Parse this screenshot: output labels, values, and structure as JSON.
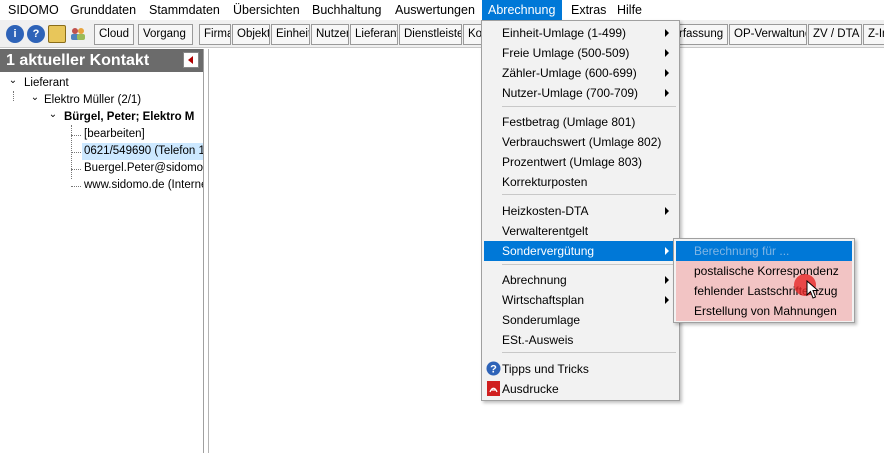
{
  "menubar": {
    "items": [
      "SIDOMO",
      "Grunddaten",
      "Stammdaten",
      "Übersichten",
      "Buchhaltung",
      "Auswertungen",
      "Abrechnung",
      "Extras",
      "Hilfe"
    ],
    "active": "Abrechnung"
  },
  "toolbar": {
    "icons": [
      "info-icon",
      "help-icon",
      "notes-icon",
      "users-icon"
    ],
    "icon_letters": [
      "i",
      "?"
    ],
    "buttons": [
      "Cloud",
      "Vorgang",
      "Firma",
      "Objekt",
      "Einheit",
      "Nutzer",
      "Lieferant",
      "Dienstleister",
      "Ko",
      "rfassung",
      "OP-Verwaltung",
      "ZV / DTA",
      "Z-In"
    ]
  },
  "leftpanel": {
    "header": "1 aktueller Kontakt",
    "tree": [
      {
        "label": "Lieferant",
        "expander": "⌄"
      },
      {
        "label": "Elektro Müller (2/1)",
        "expander": "⌄"
      },
      {
        "label": "Bürgel, Peter; Elektro M",
        "expander": "⌄"
      },
      {
        "label": "[bearbeiten]"
      },
      {
        "label": "0621/549690 (Telefon 1",
        "selected": true
      },
      {
        "label": "Buergel.Peter@sidomo.d"
      },
      {
        "label": "www.sidomo.de (Internet"
      }
    ]
  },
  "dropdown": {
    "items": [
      {
        "label": "Einheit-Umlage (1-499)",
        "submenu": true
      },
      {
        "label": "Freie Umlage (500-509)",
        "submenu": true
      },
      {
        "label": "Zähler-Umlage (600-699)",
        "submenu": true
      },
      {
        "label": "Nutzer-Umlage (700-709)",
        "submenu": true
      },
      {
        "label": "Festbetrag (Umlage 801)"
      },
      {
        "label": "Verbrauchswert (Umlage 802)"
      },
      {
        "label": "Prozentwert (Umlage 803)"
      },
      {
        "label": "Korrekturposten"
      },
      {
        "label": "Heizkosten-DTA",
        "submenu": true
      },
      {
        "label": "Verwalterentgelt"
      },
      {
        "label": "Sondervergütung",
        "submenu": true,
        "highlighted": true
      },
      {
        "label": "Abrechnung",
        "submenu": true
      },
      {
        "label": "Wirtschaftsplan",
        "submenu": true
      },
      {
        "label": "Sonderumlage"
      },
      {
        "label": "ESt.-Ausweis"
      },
      {
        "label": "Tipps und Tricks",
        "icon": "help-circle-icon"
      },
      {
        "label": "Ausdrucke",
        "icon": "pdf-icon"
      }
    ]
  },
  "submenu": {
    "items": [
      {
        "label": "Berechnung für ...",
        "disabled": true
      },
      {
        "label": "postalische Korrespondenz"
      },
      {
        "label": "fehlender Lastschrifteinzug"
      },
      {
        "label": "Erstellung von Mahnungen"
      }
    ]
  },
  "colors": {
    "highlight": "#0078d7",
    "panel_header": "#6b6b6b",
    "submenu_hot": "#f2c4c4",
    "pointer": "#e62828"
  }
}
